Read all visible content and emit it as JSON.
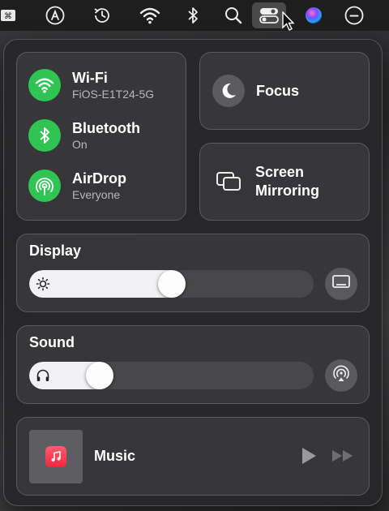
{
  "menubar": {
    "items": [
      {
        "name": "keyboard-input-icon"
      },
      {
        "name": "app-store-icon"
      },
      {
        "name": "time-machine-icon"
      },
      {
        "name": "wifi-icon"
      },
      {
        "name": "bluetooth-icon"
      },
      {
        "name": "spotlight-search-icon"
      },
      {
        "name": "control-center-icon",
        "active": true
      },
      {
        "name": "siri-icon"
      },
      {
        "name": "focus-status-icon"
      }
    ]
  },
  "connectivity": {
    "wifi": {
      "title": "Wi-Fi",
      "subtitle": "FiOS-E1T24-5G",
      "icon": "wifi-icon"
    },
    "bluetooth": {
      "title": "Bluetooth",
      "subtitle": "On",
      "icon": "bluetooth-icon"
    },
    "airdrop": {
      "title": "AirDrop",
      "subtitle": "Everyone",
      "icon": "airdrop-icon"
    },
    "accent_color": "#30c553"
  },
  "focus": {
    "label": "Focus",
    "icon": "moon-icon"
  },
  "screen_mirroring": {
    "line1": "Screen",
    "line2": "Mirroring",
    "icon": "screen-mirroring-icon"
  },
  "display": {
    "title": "Display",
    "brightness_level": 0.5,
    "icon": "sun-icon",
    "side_button_icon": "display-icon"
  },
  "sound": {
    "title": "Sound",
    "volume_level": 0.22,
    "icon": "headphones-icon",
    "side_button_icon": "airplay-audio-icon"
  },
  "now_playing": {
    "app": "Music",
    "icon": "music-note-icon",
    "play_icon": "play-icon",
    "forward_icon": "fast-forward-icon"
  }
}
